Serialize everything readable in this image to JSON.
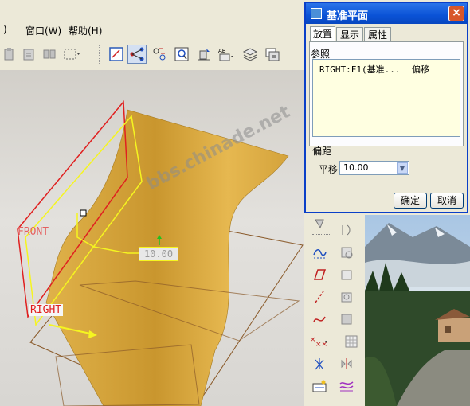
{
  "menubar": {
    "items": [
      {
        "label": ")"
      },
      {
        "label": "窗口(W)"
      },
      {
        "label": "帮助(H)"
      }
    ]
  },
  "viewport": {
    "labels": {
      "front": "FRONT",
      "right": "RIGHT",
      "offset_value": "10.00"
    }
  },
  "dialog": {
    "title": "基准平面",
    "close": "×",
    "tabs": [
      {
        "label": "放置",
        "selected": true
      },
      {
        "label": "显示",
        "selected": false
      },
      {
        "label": "属性",
        "selected": false
      }
    ],
    "references": {
      "label": "参照",
      "entries": [
        {
          "entity": "RIGHT:F1(基准...",
          "type": "偏移"
        }
      ]
    },
    "offset": {
      "label": "偏距",
      "translation_label": "平移",
      "translation_value": "10.00"
    },
    "ok_label": "确定",
    "cancel_label": "取消"
  },
  "watermark": "bbs.chinade.net",
  "colors": {
    "title_bar": "#0a52d6",
    "surface": "#d6a640",
    "datum_plane_red": "#e02020",
    "datum_plane_yellow": "#f5f520",
    "plane_outline": "#8a5a2a"
  }
}
